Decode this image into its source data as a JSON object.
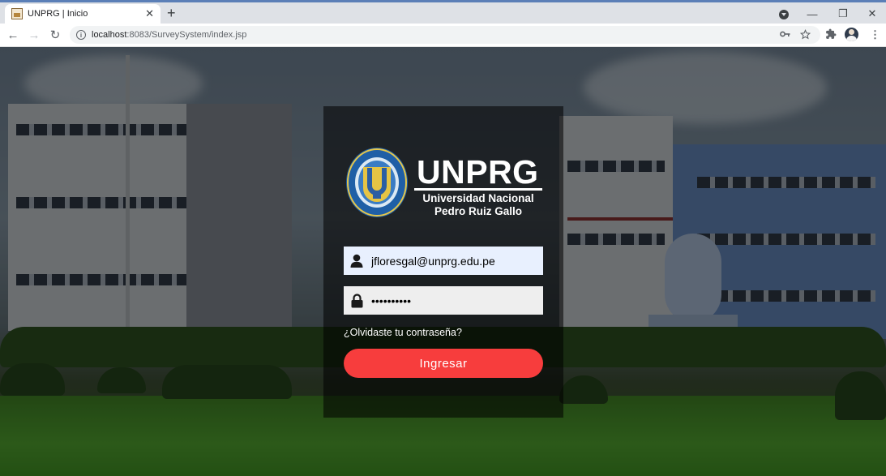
{
  "browser": {
    "tab": {
      "title": "UNPRG | Inicio",
      "close_glyph": "✕",
      "favicon": "page-favicon"
    },
    "new_tab_glyph": "+",
    "window_controls": {
      "minimize": "—",
      "maximize": "❐",
      "close": "✕"
    },
    "nav": {
      "back": "←",
      "forward": "→",
      "reload": "↻"
    },
    "url_host": "localhost",
    "url_path": ":8083/SurveySystem/index.jsp",
    "omnibox_icons": [
      "key-icon",
      "star-icon"
    ],
    "toolbar_icons": [
      "extensions-icon",
      "profile-avatar",
      "menu-icon"
    ]
  },
  "login": {
    "brand": {
      "title": "UNPRG",
      "subtitle_line1": "Universidad Nacional",
      "subtitle_line2": "Pedro Ruiz Gallo"
    },
    "username": {
      "value": "jfloresgal@unprg.edu.pe",
      "icon": "user-icon"
    },
    "password": {
      "value": "••••••••••",
      "icon": "lock-icon"
    },
    "forgot_password": "¿Olvidaste tu contraseña?",
    "submit_label": "Ingresar",
    "colors": {
      "button": "#f73d3d",
      "panel": "rgba(0,0,0,0.55)"
    }
  }
}
